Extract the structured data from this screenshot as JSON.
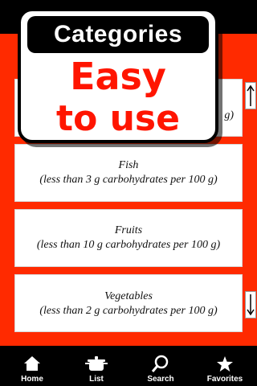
{
  "promo": {
    "title": "Categories",
    "line1": "Easy",
    "line2": "to use"
  },
  "categories": [
    {
      "name": "",
      "description": "g)"
    },
    {
      "name": "Fish",
      "description": "(less than 3 g carbohydrates per 100 g)"
    },
    {
      "name": "Fruits",
      "description": "(less than 10 g carbohydrates per 100 g)"
    },
    {
      "name": "Vegetables",
      "description": "(less than 2 g carbohydrates per 100 g)"
    }
  ],
  "scroll": {
    "up_icon": "arrow-up-icon",
    "down_icon": "arrow-down-icon"
  },
  "tabs": [
    {
      "label": "Home",
      "icon": "home-icon"
    },
    {
      "label": "List",
      "icon": "pot-icon"
    },
    {
      "label": "Search",
      "icon": "search-icon"
    },
    {
      "label": "Favorites",
      "icon": "star-icon"
    }
  ],
  "colors": {
    "accent": "#ff2a00",
    "bar": "#000000",
    "card": "#ffffff"
  }
}
